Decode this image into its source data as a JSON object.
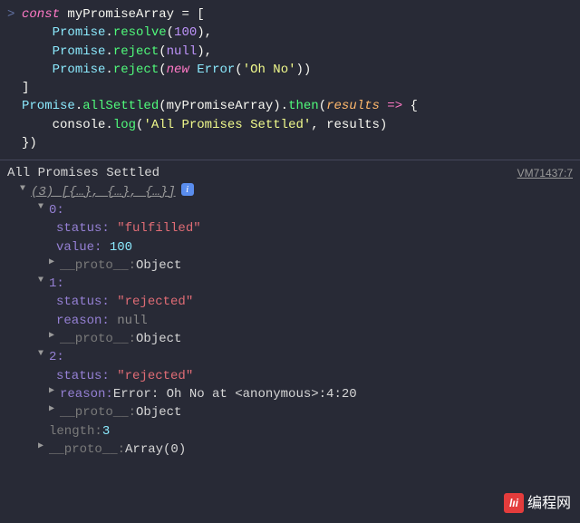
{
  "input": {
    "line1_kw_const": "const",
    "line1_var": " myPromiseArray ",
    "line1_eq": "= [",
    "line2_pad": "    ",
    "line2_class": "Promise",
    "line2_dot": ".",
    "line2_fn": "resolve",
    "line2_open": "(",
    "line2_arg": "100",
    "line2_close": "),",
    "line3_pad": "    ",
    "line3_class": "Promise",
    "line3_dot": ".",
    "line3_fn": "reject",
    "line3_open": "(",
    "line3_arg": "null",
    "line3_close": "),",
    "line4_pad": "    ",
    "line4_class": "Promise",
    "line4_dot": ".",
    "line4_fn": "reject",
    "line4_open": "(",
    "line4_new": "new ",
    "line4_err": "Error",
    "line4_open2": "(",
    "line4_str": "'Oh No'",
    "line4_close2": ")",
    "line4_close": ")",
    "line5": "]",
    "line6_class": "Promise",
    "line6_dot": ".",
    "line6_fn": "allSettled",
    "line6_open": "(",
    "line6_arg": "myPromiseArray",
    "line6_close": ").",
    "line6_then": "then",
    "line6_open2": "(",
    "line6_param": "results",
    "line6_arrow": " => ",
    "line6_brace": "{",
    "line7_pad": "    ",
    "line7_obj": "console",
    "line7_dot": ".",
    "line7_fn": "log",
    "line7_open": "(",
    "line7_str": "'All Promises Settled'",
    "line7_comma": ", ",
    "line7_arg": "results",
    "line7_close": ")",
    "line8": "})"
  },
  "log": {
    "header_text": "All Promises Settled",
    "vm": "VM71437:7",
    "array_preview": "(3) [{…}, {…}, {…}]",
    "info_glyph": "i",
    "items": [
      {
        "idx": "0:",
        "k_status": "status:",
        "v_status": "\"fulfilled\"",
        "k_value": "value:",
        "v_value": "100",
        "k_proto": "__proto__:",
        "v_proto": " Object"
      },
      {
        "idx": "1:",
        "k_status": "status:",
        "v_status": "\"rejected\"",
        "k_reason": "reason:",
        "v_reason": "null",
        "k_proto": "__proto__:",
        "v_proto": " Object"
      },
      {
        "idx": "2:",
        "k_status": "status:",
        "v_status": "\"rejected\"",
        "k_reason": "reason:",
        "v_reason": " Error: Oh No at <anonymous>:4:20",
        "k_proto": "__proto__:",
        "v_proto": " Object"
      }
    ],
    "length_key": "length:",
    "length_val": " 3",
    "proto_key": "__proto__:",
    "proto_val": " Array(0)"
  },
  "watermark": {
    "logo": "lıi",
    "text": "编程网"
  }
}
